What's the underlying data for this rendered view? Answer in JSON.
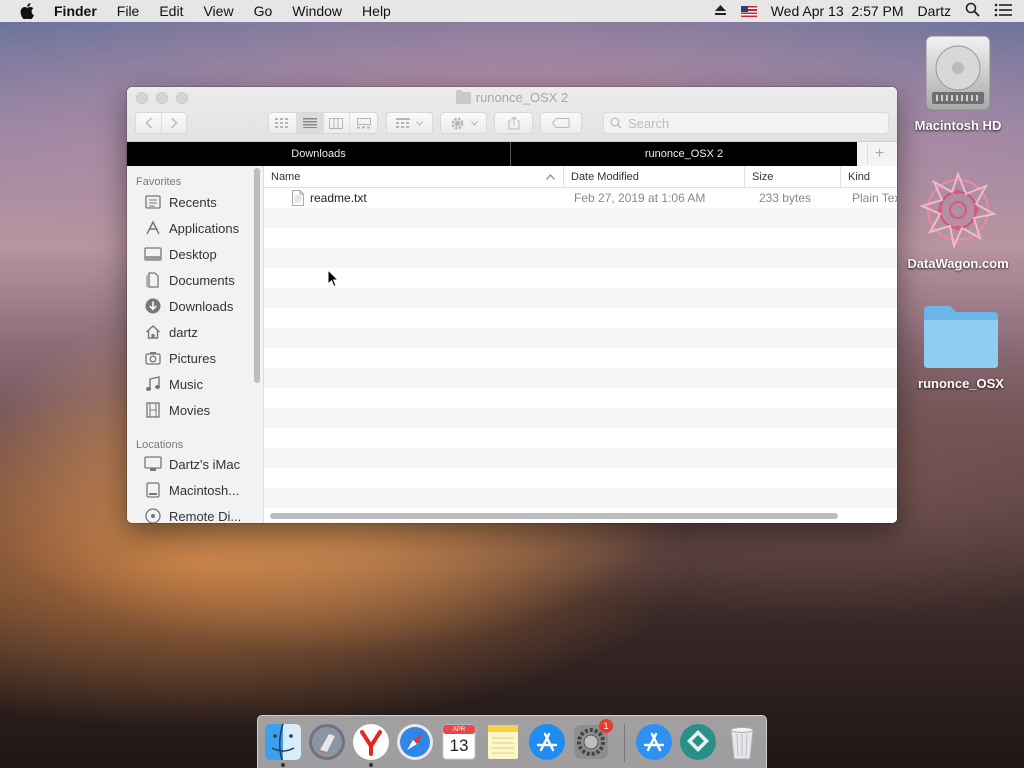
{
  "menubar": {
    "items": [
      "Finder",
      "File",
      "Edit",
      "View",
      "Go",
      "Window",
      "Help"
    ],
    "datetime": "Wed Apr 13  2:57 PM",
    "user": "Dartz"
  },
  "desktop": {
    "icons": [
      {
        "label": "Macintosh HD"
      },
      {
        "label": "DataWagon.com"
      },
      {
        "label": "runonce_OSX"
      }
    ]
  },
  "window": {
    "title": "runonce_OSX 2",
    "search_placeholder": "Search",
    "tabs": [
      {
        "label": "Downloads"
      },
      {
        "label": "runonce_OSX 2"
      }
    ],
    "sidebar": {
      "favorites_header": "Favorites",
      "favorites": [
        {
          "label": "Recents",
          "icon": "recents-icon"
        },
        {
          "label": "Applications",
          "icon": "applications-icon"
        },
        {
          "label": "Desktop",
          "icon": "desktop-icon"
        },
        {
          "label": "Documents",
          "icon": "documents-icon"
        },
        {
          "label": "Downloads",
          "icon": "downloads-icon"
        },
        {
          "label": "dartz",
          "icon": "home-icon"
        },
        {
          "label": "Pictures",
          "icon": "camera-icon"
        },
        {
          "label": "Music",
          "icon": "music-icon"
        },
        {
          "label": "Movies",
          "icon": "film-icon"
        }
      ],
      "locations_header": "Locations",
      "locations": [
        {
          "label": "Dartz's iMac",
          "icon": "imac-icon"
        },
        {
          "label": "Macintosh...",
          "icon": "disk-icon"
        },
        {
          "label": "Remote Di...",
          "icon": "remote-disc-icon"
        }
      ]
    },
    "columns": {
      "name": "Name",
      "date": "Date Modified",
      "size": "Size",
      "kind": "Kind"
    },
    "files": [
      {
        "name": "readme.txt",
        "date": "Feb 27, 2019 at 1:06 AM",
        "size": "233 bytes",
        "kind": "Plain Text"
      }
    ]
  },
  "dock": {
    "calendar_month": "APR",
    "calendar_day": "13",
    "badge": "1",
    "items": [
      "finder-icon",
      "launchpad-icon",
      "yandex-browser-icon",
      "safari-icon",
      "calendar-icon",
      "notes-icon",
      "app-store-icon",
      "system-preferences-icon",
      "app-store-icon-2",
      "sourcetree-icon",
      "trash-icon"
    ]
  }
}
